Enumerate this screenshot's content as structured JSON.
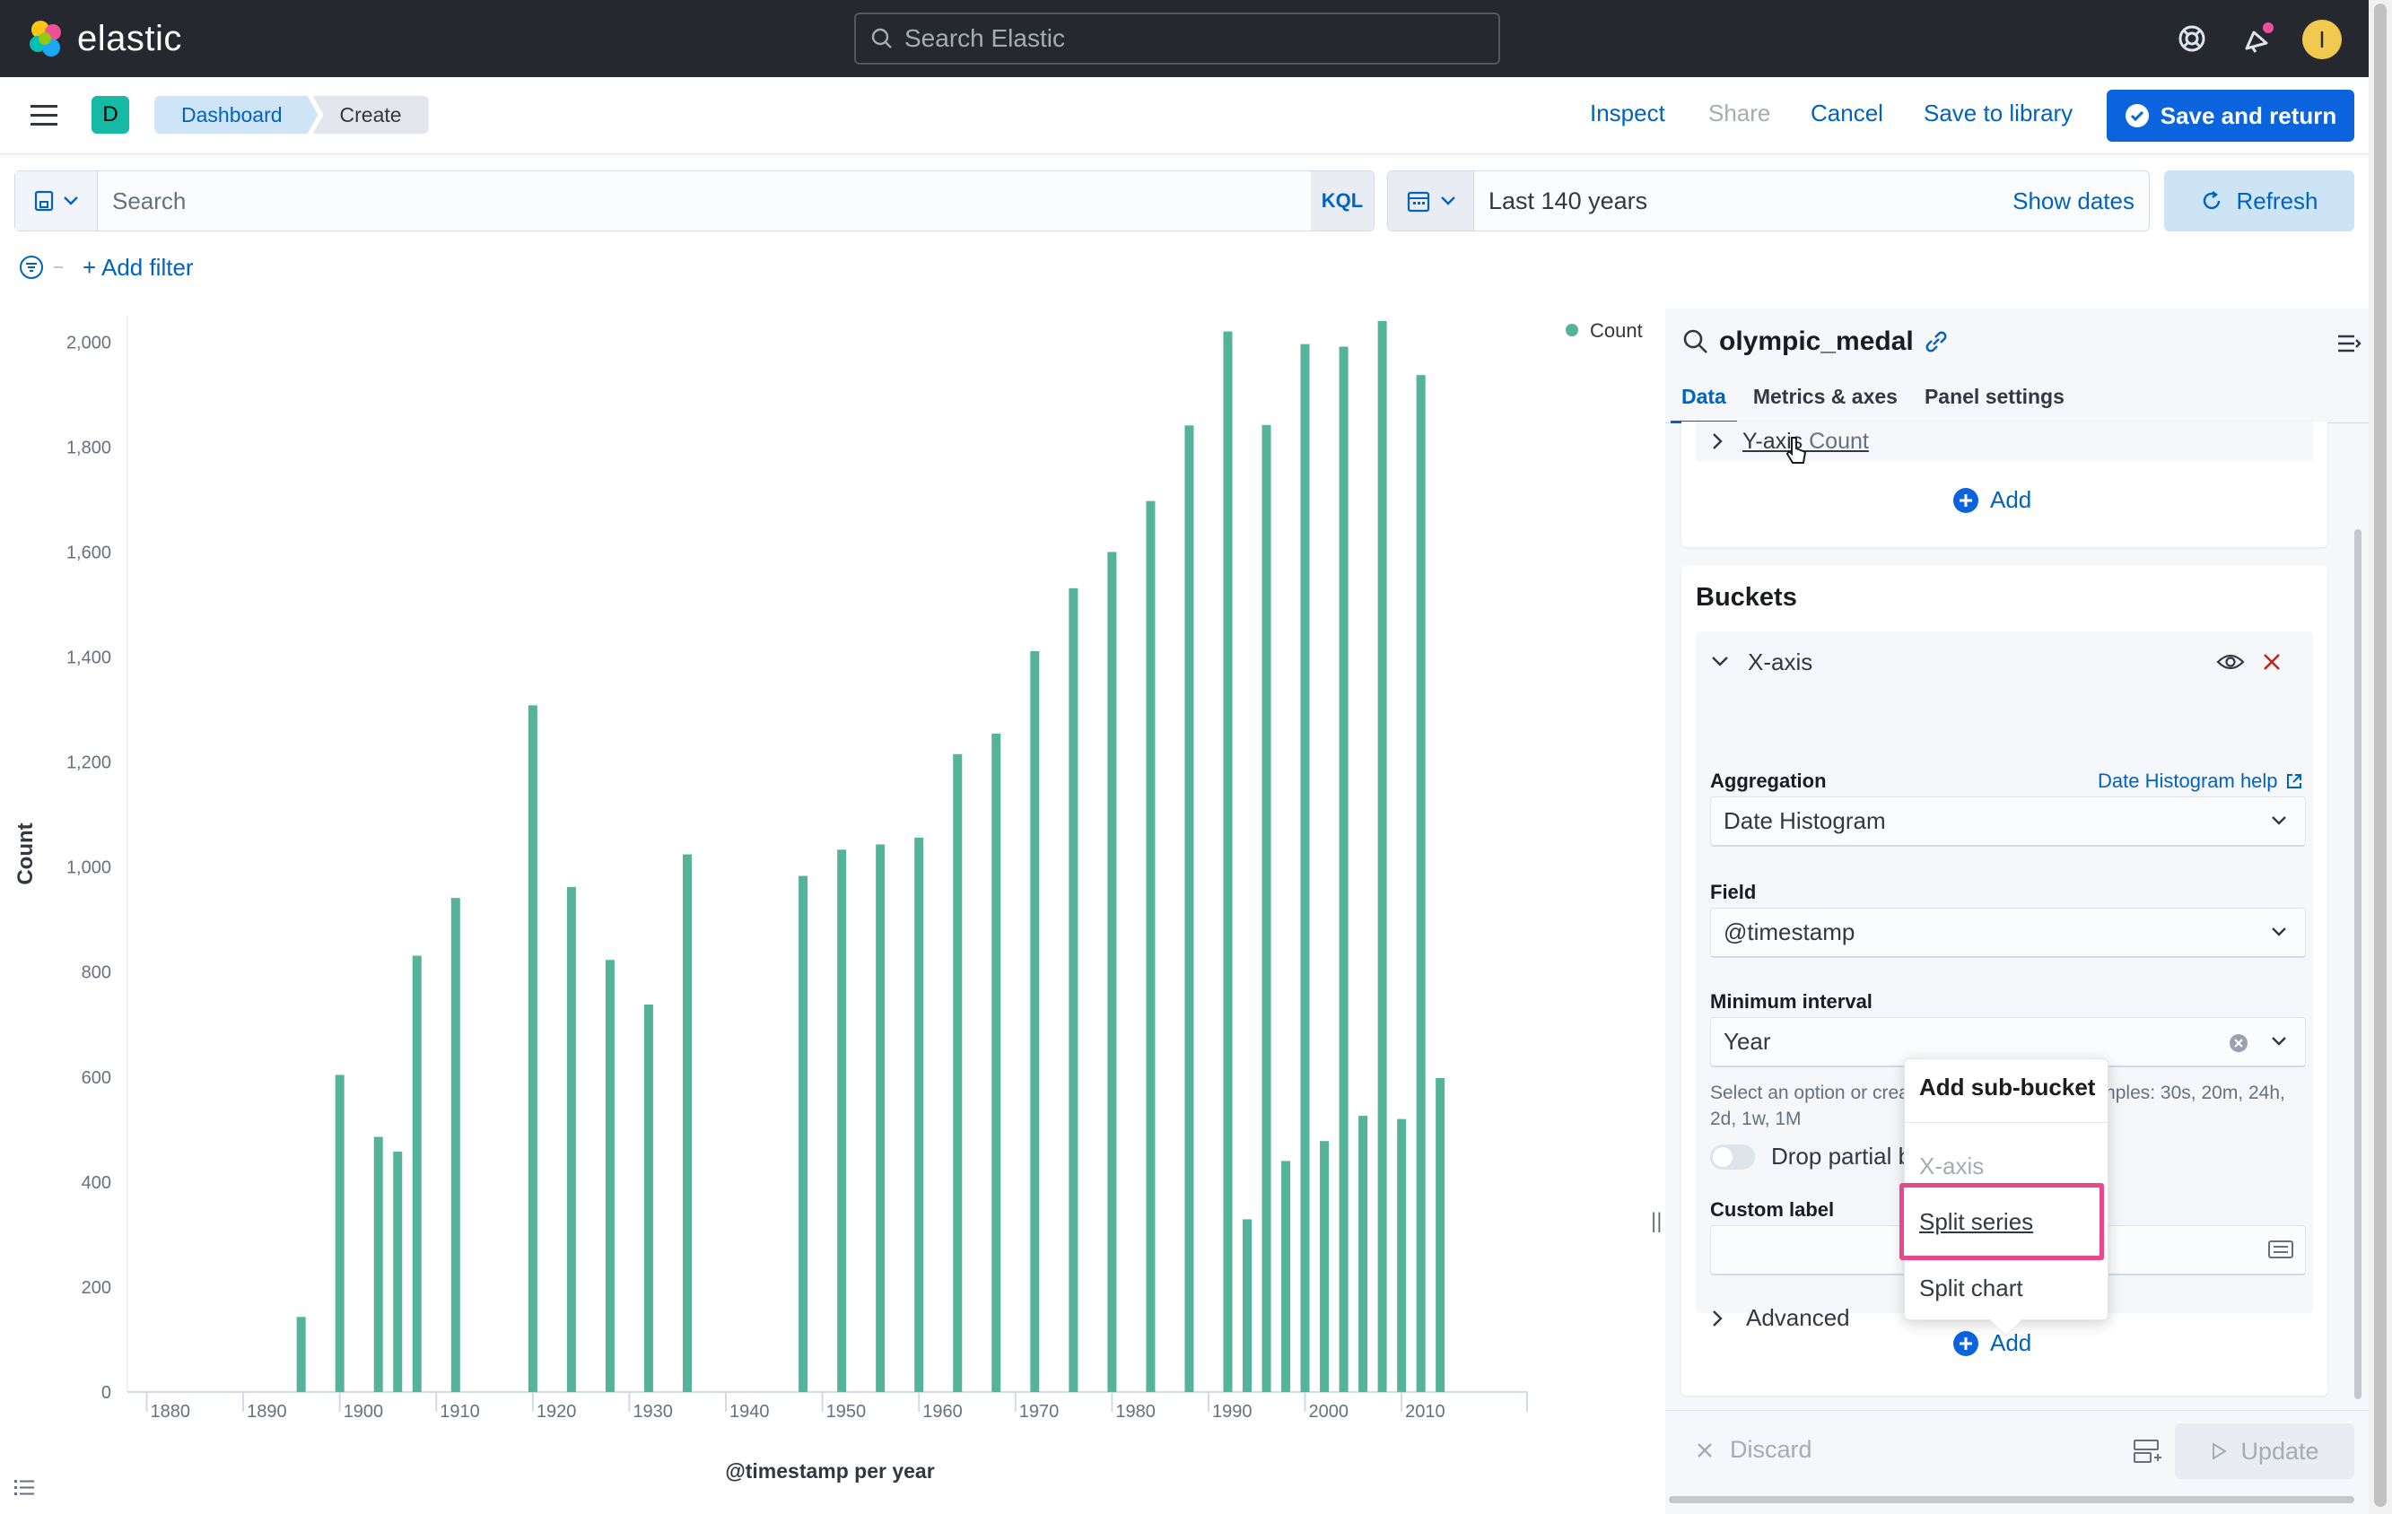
{
  "header": {
    "logo_text": "elastic",
    "search_placeholder": "Search Elastic",
    "avatar_initial": "I",
    "icons": [
      "help-icon",
      "newsfeed-icon",
      "avatar"
    ]
  },
  "nav": {
    "space_initial": "D",
    "breadcrumbs": [
      "Dashboard",
      "Create"
    ],
    "inspect": "Inspect",
    "share": "Share",
    "cancel": "Cancel",
    "save_to_library": "Save to library",
    "save_and_return": "Save and return"
  },
  "query": {
    "placeholder": "Search",
    "language": "KQL",
    "date_range": "Last 140 years",
    "show_dates": "Show dates",
    "refresh": "Refresh",
    "add_filter": "+ Add filter"
  },
  "chart_data": {
    "type": "bar",
    "ylabel": "Count",
    "xlabel": "@timestamp per year",
    "legend": {
      "entries": [
        "Count"
      ],
      "placement": "top-right"
    },
    "colors": {
      "bar": "#54b399"
    },
    "ylim": [
      0,
      2050
    ],
    "xlim": [
      1878,
      2023
    ],
    "yticks": [
      "0",
      "200",
      "400",
      "600",
      "800",
      "1,000",
      "1,200",
      "1,400",
      "1,600",
      "1,800",
      "2,000"
    ],
    "xticks": [
      "1880",
      "1890",
      "1900",
      "1910",
      "1920",
      "1930",
      "1940",
      "1950",
      "1960",
      "1970",
      "1980",
      "1990",
      "2000",
      "2010"
    ],
    "x": [
      1896,
      1900,
      1904,
      1906,
      1908,
      1912,
      1920,
      1924,
      1928,
      1932,
      1936,
      1948,
      1952,
      1956,
      1960,
      1964,
      1968,
      1972,
      1976,
      1980,
      1984,
      1988,
      1992,
      1994,
      1996,
      1998,
      2000,
      2002,
      2004,
      2006,
      2008,
      2010,
      2012,
      2014
    ],
    "values": [
      143,
      604,
      486,
      458,
      831,
      941,
      1308,
      962,
      823,
      738,
      1024,
      983,
      1033,
      1043,
      1056,
      1215,
      1254,
      1411,
      1531,
      1600,
      1697,
      1841,
      2020,
      329,
      1842,
      440,
      1996,
      478,
      1991,
      526,
      2040,
      520,
      1937,
      598
    ]
  },
  "editor": {
    "index_pattern": "olympic_medal",
    "tabs": [
      "Data",
      "Metrics & axes",
      "Panel settings"
    ],
    "metrics": {
      "yaxis_label": "Y-axis",
      "yaxis_value": "Count",
      "add": "Add"
    },
    "buckets": {
      "title": "Buckets",
      "xaxis": "X-axis",
      "aggregation_label": "Aggregation",
      "aggregation_help": "Date Histogram help",
      "aggregation_value": "Date Histogram",
      "field_label": "Field",
      "field_value": "@timestamp",
      "interval_label": "Minimum interval",
      "interval_value": "Year",
      "interval_help": "Select an option or create a custom value. Examples: 30s, 20m, 24h, 2d, 1w, 1M",
      "drop_partial": "Drop partial b",
      "custom_label": "Custom label",
      "custom_value": "",
      "advanced": "Advanced",
      "add": "Add"
    },
    "popover": {
      "title": "Add sub-bucket",
      "items": [
        "X-axis",
        "Split series",
        "Split chart"
      ]
    },
    "footer": {
      "discard": "Discard",
      "update": "Update"
    }
  }
}
